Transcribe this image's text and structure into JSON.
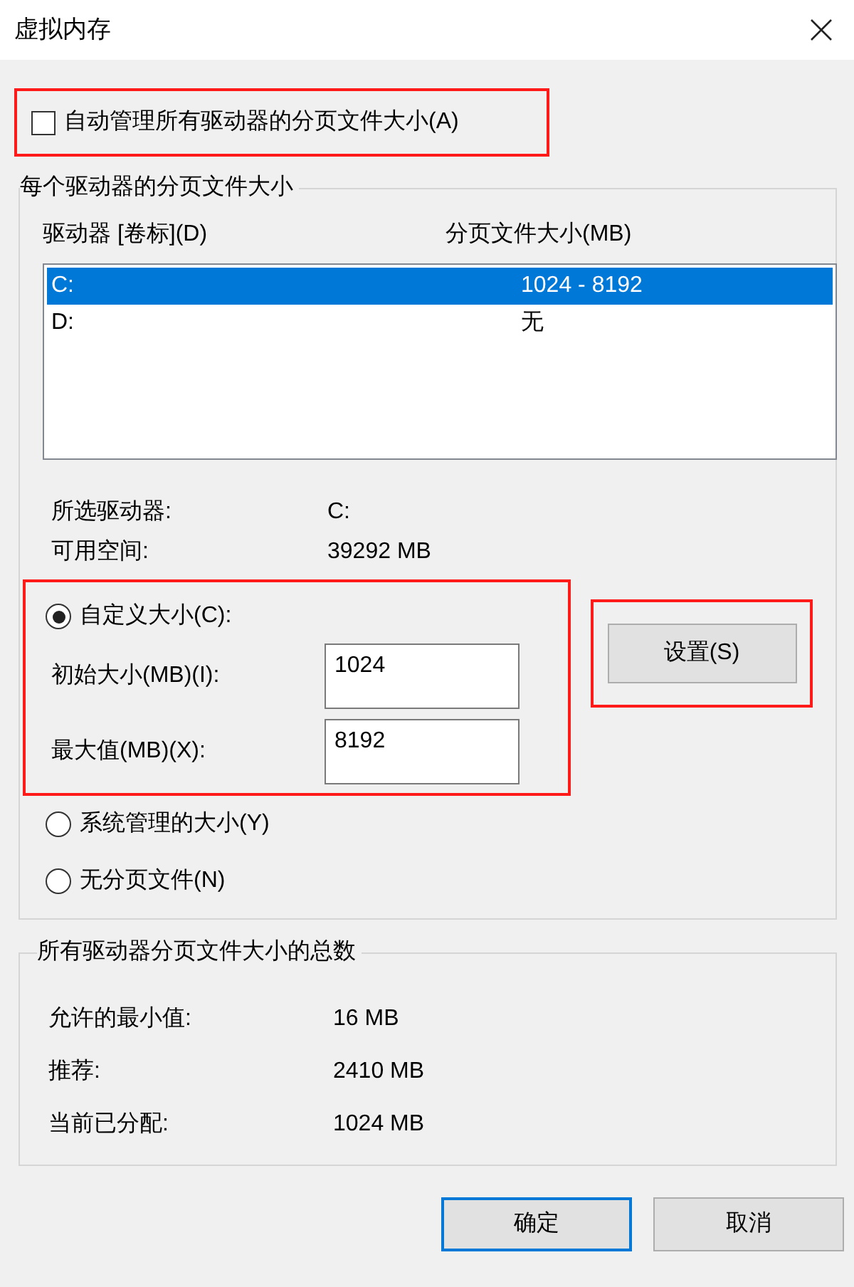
{
  "window": {
    "title": "虚拟内存"
  },
  "auto_manage": {
    "label": "自动管理所有驱动器的分页文件大小(A)",
    "checked": false,
    "highlighted": true
  },
  "per_drive": {
    "title": "每个驱动器的分页文件大小",
    "columns": [
      "驱动器 [卷标](D)",
      "分页文件大小(MB)"
    ],
    "rows": [
      {
        "drive": "C:",
        "size": "1024 - 8192",
        "selected": true
      },
      {
        "drive": "D:",
        "size": "无",
        "selected": false
      }
    ],
    "info": [
      {
        "label": "所选驱动器:",
        "value": "C:"
      },
      {
        "label": "可用空间:",
        "value": "39292 MB"
      }
    ],
    "options": [
      {
        "label": "自定义大小(C):",
        "selected": true,
        "highlighted": true,
        "fields": [
          {
            "label": "初始大小(MB)(I):",
            "value": "1024"
          },
          {
            "label": "最大值(MB)(X):",
            "value": "8192"
          }
        ]
      },
      {
        "label": "系统管理的大小(Y)",
        "selected": false,
        "highlighted": false
      },
      {
        "label": "无分页文件(N)",
        "selected": false,
        "highlighted": false
      }
    ],
    "set_button": {
      "label": "设置(S)",
      "highlighted": true
    }
  },
  "totals": {
    "title": "所有驱动器分页文件大小的总数",
    "rows": [
      {
        "label": "允许的最小值:",
        "value": "16 MB"
      },
      {
        "label": "推荐:",
        "value": "2410 MB"
      },
      {
        "label": "当前已分配:",
        "value": "1024 MB"
      }
    ]
  },
  "buttons": [
    {
      "label": "确定",
      "default": true
    },
    {
      "label": "取消",
      "default": false
    }
  ]
}
